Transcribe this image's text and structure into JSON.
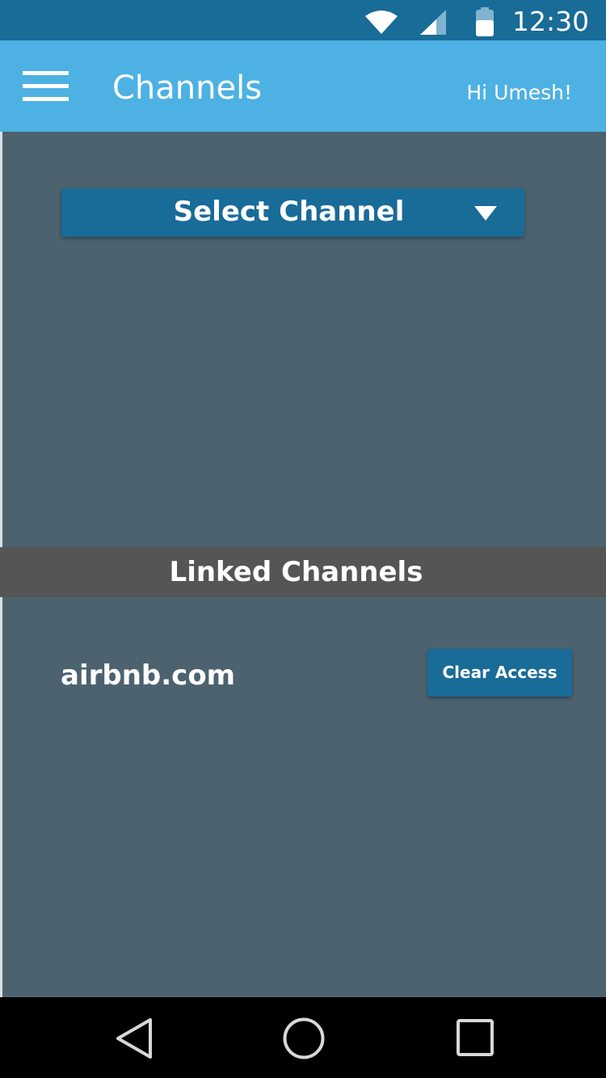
{
  "status_bar": {
    "time": "12:30",
    "icons": [
      "wifi-icon",
      "cell-signal-icon",
      "battery-icon"
    ]
  },
  "app_bar": {
    "menu_icon": "hamburger-menu-icon",
    "title": "Channels",
    "greeting": "Hi Umesh!",
    "background": "#4db1e3"
  },
  "main": {
    "background": "#4c626f",
    "select": {
      "label": "Select Channel",
      "icon": "dropdown-caret-icon"
    },
    "linked": {
      "title": "Linked Channels",
      "items": [
        {
          "name": "airbnb.com",
          "action_label": "Clear Access"
        }
      ]
    }
  },
  "nav_bar": {
    "icons": [
      "back-icon",
      "home-icon",
      "recents-icon"
    ]
  },
  "colors": {
    "status_bar": "#196b98",
    "button": "#196b98",
    "section_header": "#555555"
  }
}
